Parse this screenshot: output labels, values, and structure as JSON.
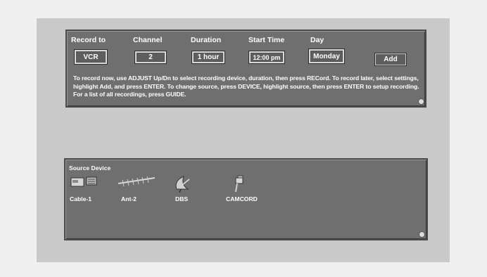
{
  "record": {
    "headers": {
      "record_to": "Record to",
      "channel": "Channel",
      "duration": "Duration",
      "start_time": "Start Time",
      "day": "Day"
    },
    "values": {
      "record_to": "VCR",
      "channel": "2",
      "duration": "1 hour",
      "start_time": "12:00 pm",
      "day": "Monday"
    },
    "add_label": "Add",
    "instructions": "To record now, use ADJUST Up/Dn to select recording device, duration, then press RECord.  To record later, select settings, highlight Add, and press ENTER.  To change source, press DEVICE, highlight source, then press ENTER to setup recording.  For a list of all recordings, press GUIDE."
  },
  "source": {
    "title": "Source Device",
    "devices": [
      {
        "label": "Cable-1",
        "icon": "cable-box-icon"
      },
      {
        "label": "Ant-2",
        "icon": "antenna-icon"
      },
      {
        "label": "DBS",
        "icon": "satellite-dish-icon"
      },
      {
        "label": "CAMCORD",
        "icon": "camcorder-icon"
      }
    ]
  },
  "colors": {
    "page_bg": "#f0f0f0",
    "screen_bg": "#c9c9c9",
    "panel_bg": "#6f6f6f",
    "text": "#ffffff"
  }
}
